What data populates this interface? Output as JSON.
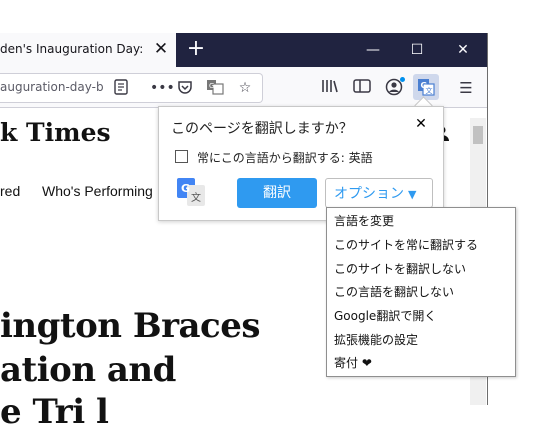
{
  "browser": {
    "tab_title": "den's Inauguration Day: Live",
    "tab_close": "✕",
    "new_tab": "+",
    "window_buttons": {
      "minimize": "—",
      "maximize": "☐",
      "close": "✕"
    },
    "url_text": "auguration-day-b",
    "icons": {
      "reader": "reader-view-icon",
      "more": "more-actions-icon",
      "pocket": "pocket-icon",
      "translate_page": "translate-icon",
      "bookmark": "star-icon",
      "library": "library-icon",
      "sidebar": "sidebar-icon",
      "account": "account-icon",
      "translate_ext": "translate-extension-icon",
      "menu": "hamburger-menu-icon"
    }
  },
  "page": {
    "logo": "k Times",
    "nav": [
      "red",
      "Who's Performing"
    ],
    "headline_lines": [
      "ington Braces",
      "ation and",
      "e Tri l"
    ]
  },
  "popup": {
    "title": "このページを翻訳しますか？",
    "close": "✕",
    "checkbox_label": "常にこの言語から翻訳する: 英語",
    "checkbox_checked": false,
    "translate_button": "翻訳",
    "options_button": "オプション",
    "accent_color": "#2f9af0"
  },
  "menu": {
    "items": [
      "言語を変更",
      "このサイトを常に翻訳する",
      "このサイトを翻訳しない",
      "この言語を翻訳しない",
      "Google翻訳で開く",
      "拡張機能の設定",
      "寄付 ❤"
    ]
  }
}
